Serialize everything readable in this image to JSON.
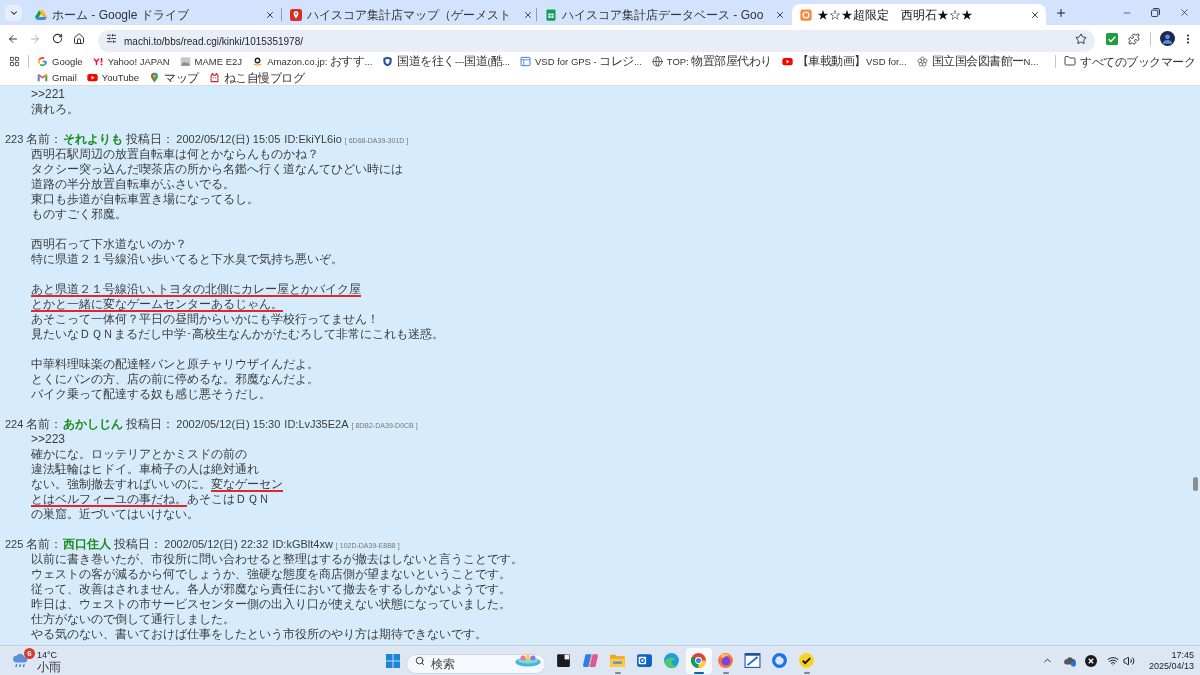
{
  "browser": {
    "tabs": [
      {
        "kind": "drive",
        "title": "ホーム - Google ドライブ",
        "selected": false
      },
      {
        "kind": "map",
        "title": "ハイスコア集計店マップ（ゲーメスト",
        "selected": false
      },
      {
        "kind": "sheet",
        "title": "ハイスコア集計店データベース - Goo",
        "selected": false
      },
      {
        "kind": "site",
        "title": "★☆★超限定　西明石★☆★",
        "selected": true
      }
    ],
    "navigation": {
      "back_disabled": false,
      "forward_disabled": true
    },
    "address": "machi.to/bbs/read.cgi/kinki/1015351978/",
    "bookmarks": [
      {
        "kind": "google",
        "label": "Google"
      },
      {
        "kind": "yahoo",
        "label": "Yahoo! JAPAN"
      },
      {
        "kind": "image",
        "label": "MAME E2J"
      },
      {
        "kind": "amazon",
        "label": "Amazon.co.jp: おすす..."
      },
      {
        "kind": "shield",
        "label": "国道を往く---国道(酷..."
      },
      {
        "kind": "doc",
        "label": "VSD for GPS - コレジ..."
      },
      {
        "kind": "globe",
        "label": "TOP: 物置部屋代わり"
      },
      {
        "kind": "youtube",
        "label": "【車載動画】VSD for..."
      },
      {
        "kind": "flower",
        "label": "国立国会図書館ーN..."
      },
      {
        "kind": "gmail",
        "label": "Gmail"
      },
      {
        "kind": "youtube",
        "label": "YouTube"
      },
      {
        "kind": "maps",
        "label": "マップ"
      },
      {
        "kind": "cat",
        "label": "ねこ自慢ブログ"
      }
    ],
    "all_bookmarks": "すべてのブックマーク"
  },
  "thread": {
    "posts": [
      {
        "body": [
          [
            ">>221",
            "潰れろ。"
          ]
        ]
      },
      {
        "header": {
          "number": "223",
          "name_label": "名前：",
          "name": "それよりも",
          "date_label": "投稿日：",
          "date": "2002/05/12(日) 15:05",
          "id": "ID:EkiYL6io",
          "host": "[ 6D68-DA39-301D ]"
        },
        "body": [
          [
            "西明石駅周辺の放置自転車は何とかならんものかね？",
            "タクシー突っ込んだ喫茶店の所から名鑑へ行く道なんてひどい時には",
            "道路の半分放置自転車がふさいでる。",
            "東口も歩道が自転車置き場になってるし。",
            "ものすごく邪魔。"
          ],
          [
            "西明石って下水道ないのか？",
            "特に県道２１号線沿い歩いてると下水臭で気持ち悪いぞ。"
          ],
          [
            {
              "segments": [
                {
                  "text": "あと県道２１号線沿い､トヨタの北側にカレー屋とかバイク屋",
                  "underlined": true
                }
              ]
            },
            {
              "segments": [
                {
                  "text": "とかと一緒に変なゲームセンターあるじゃん。",
                  "underlined": true
                }
              ]
            },
            "あそこって一体何？平日の昼間からいかにも学校行ってません！",
            "見たいなＤＱＮまるだし中学･高校生なんかがたむろして非常にこれも迷惑。"
          ],
          [
            "中華料理味楽の配達軽バンと原チャリウザイんだよ。",
            "とくにバンの方、店の前に停めるな。邪魔なんだよ。",
            "バイク乗って配達する奴も感じ悪そうだし。"
          ]
        ]
      },
      {
        "header": {
          "number": "224",
          "name_label": "名前：",
          "name": "あかしじん",
          "date_label": "投稿日：",
          "date": "2002/05/12(日) 15:30",
          "id": "ID:LvJ35E2A",
          "host": "[ 8DB2-DA39-D0CB ]"
        },
        "body": [
          [
            ">>223",
            "確かにな。ロッテリアとかミスドの前の",
            "違法駐輪はヒドイ。車椅子の人は絶対通れ",
            {
              "segments": [
                {
                  "text": "ない。強制撤去すればいいのに。",
                  "underlined": false
                },
                {
                  "text": "変なゲーセン",
                  "underlined": true
                }
              ]
            },
            {
              "segments": [
                {
                  "text": "とはベルフィーユの事だね。",
                  "underlined": true
                },
                {
                  "text": "あそこはＤＱＮ",
                  "underlined": false
                }
              ]
            },
            "の巣窟。近づいてはいけない。"
          ]
        ]
      },
      {
        "header": {
          "number": "225",
          "name_label": "名前：",
          "name": "西口住人",
          "date_label": "投稿日：",
          "date": "2002/05/12(日) 22:32",
          "id": "ID:kGBlt4xw",
          "host": "[ 102D-DA39-E8B8 ]"
        },
        "body": [
          [
            "以前に書き巻いたが、市役所に問い合わせると整理はするが撤去はしないと言うことです。",
            "ウェストの客が減るから何でしょうか、強硬な態度を商店側が望まないということです。",
            "従って、改善はされません。各人が邪魔なら責任において撤去をするしかないようです。",
            "昨日は、ウェストの市サービスセンター側の出入り口が使えない状態になっていました。",
            "仕方がないので倒して通行しました。",
            "やる気のない、書いておけば仕事をしたという市役所のやり方は期待できないです。"
          ]
        ]
      }
    ]
  },
  "taskbar": {
    "weather": {
      "badge": "6",
      "temperature": "14°C",
      "condition": "小雨"
    },
    "search": {
      "placeholder": "検索"
    },
    "apps": [
      {
        "kind": "taskview",
        "running": false,
        "selected": false
      },
      {
        "kind": "copilot",
        "running": false,
        "selected": false
      },
      {
        "kind": "files",
        "running": true,
        "selected": false
      },
      {
        "kind": "mail",
        "running": false,
        "selected": false
      },
      {
        "kind": "edge",
        "running": false,
        "selected": false
      },
      {
        "kind": "chrome",
        "running": true,
        "selected": true
      },
      {
        "kind": "firefox",
        "running": true,
        "selected": false
      },
      {
        "kind": "paint",
        "running": false,
        "selected": false
      },
      {
        "kind": "ring",
        "running": false,
        "selected": false
      },
      {
        "kind": "check",
        "running": true,
        "selected": false
      }
    ],
    "time": "17:45",
    "date": "2025/04/13"
  }
}
